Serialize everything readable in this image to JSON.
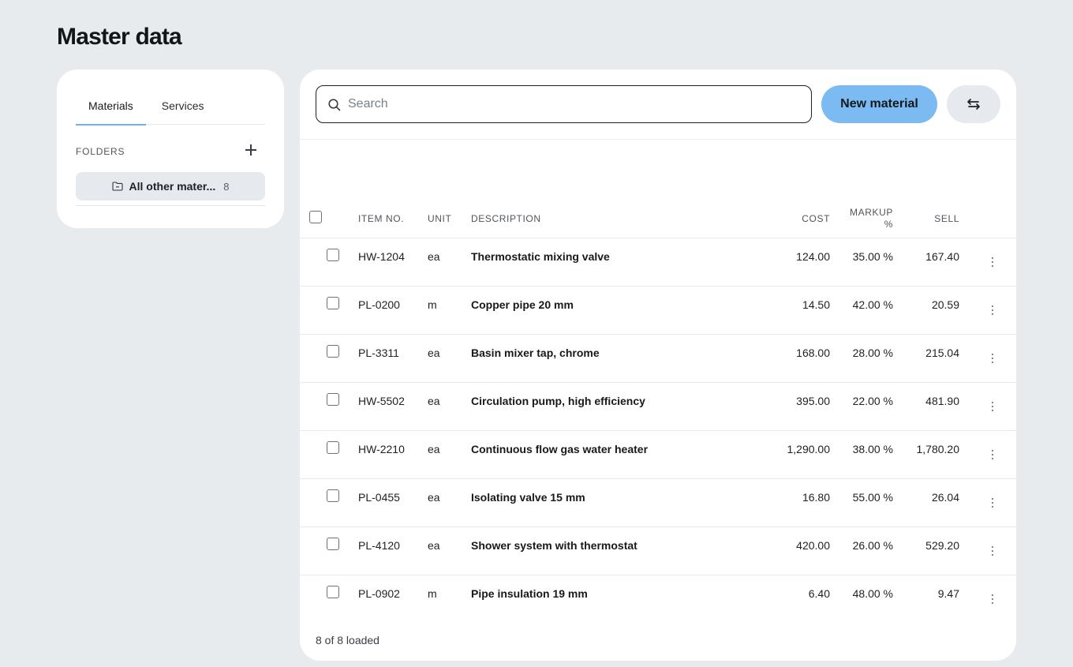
{
  "page": {
    "title": "Master data"
  },
  "sidebar": {
    "tabs": [
      {
        "label": "Materials",
        "active": true
      },
      {
        "label": "Services",
        "active": false
      }
    ],
    "folders_label": "FOLDERS",
    "folder": {
      "name": "All other mater...",
      "count": "8"
    }
  },
  "toolbar": {
    "search_placeholder": "Search",
    "search_value": "",
    "new_label": "New material"
  },
  "table": {
    "headers": {
      "item_no": "ITEM NO.",
      "unit": "UNIT",
      "description": "DESCRIPTION",
      "cost": "COST",
      "markup_line1": "MARKUP",
      "markup_line2": "%",
      "sell": "SELL"
    },
    "rows": [
      {
        "item_no": "HW-1204",
        "unit": "ea",
        "description": "Thermostatic mixing valve",
        "cost": "124.00",
        "markup": "35.00 %",
        "sell": "167.40"
      },
      {
        "item_no": "PL-0200",
        "unit": "m",
        "description": "Copper pipe 20 mm",
        "cost": "14.50",
        "markup": "42.00 %",
        "sell": "20.59"
      },
      {
        "item_no": "PL-3311",
        "unit": "ea",
        "description": "Basin mixer tap, chrome",
        "cost": "168.00",
        "markup": "28.00 %",
        "sell": "215.04"
      },
      {
        "item_no": "HW-5502",
        "unit": "ea",
        "description": "Circulation pump, high efficiency",
        "cost": "395.00",
        "markup": "22.00 %",
        "sell": "481.90"
      },
      {
        "item_no": "HW-2210",
        "unit": "ea",
        "description": "Continuous flow gas water heater",
        "cost": "1,290.00",
        "markup": "38.00 %",
        "sell": "1,780.20"
      },
      {
        "item_no": "PL-0455",
        "unit": "ea",
        "description": "Isolating valve 15 mm",
        "cost": "16.80",
        "markup": "55.00 %",
        "sell": "26.04"
      },
      {
        "item_no": "PL-4120",
        "unit": "ea",
        "description": "Shower system with thermostat",
        "cost": "420.00",
        "markup": "26.00 %",
        "sell": "529.20"
      },
      {
        "item_no": "PL-0902",
        "unit": "m",
        "description": "Pipe insulation 19 mm",
        "cost": "6.40",
        "markup": "48.00 %",
        "sell": "9.47"
      }
    ],
    "footer": "8 of 8 loaded"
  },
  "icons": {
    "search": "search-icon",
    "folder": "folder-icon",
    "add": "plus-icon",
    "swap": "swap-arrows-icon",
    "row_menu": "more-vertical-icon"
  },
  "colors": {
    "background": "#e8ebee",
    "accent": "#7cbaf2",
    "tab_underline": "#6eb3f0"
  }
}
